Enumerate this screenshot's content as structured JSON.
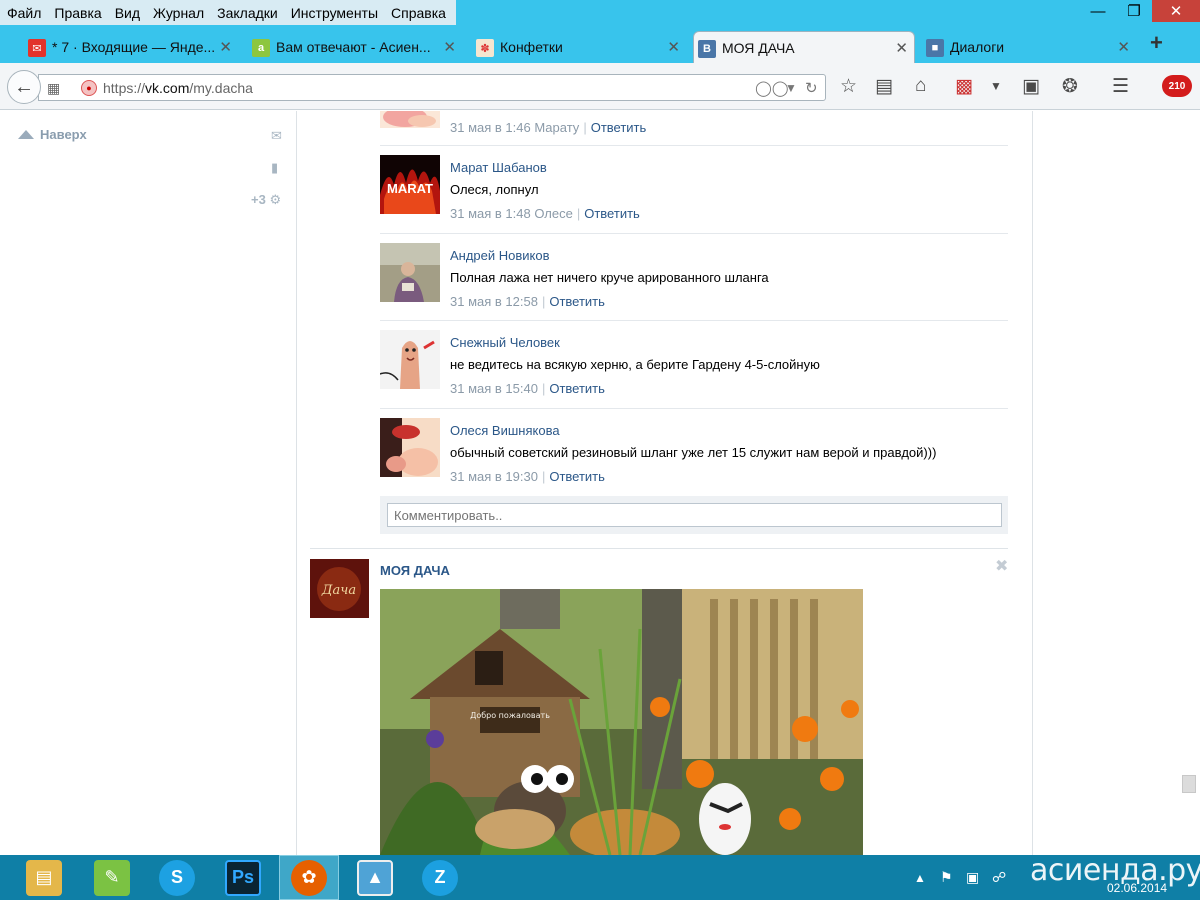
{
  "menubar": {
    "items": [
      "Файл",
      "Правка",
      "Вид",
      "Журнал",
      "Закладки",
      "Инструменты",
      "Справка"
    ]
  },
  "tabs": [
    {
      "label": "* 7 · Входящие — Янде...",
      "icon": "mail-icon",
      "color": "#e2332b"
    },
    {
      "label": "Вам отвечают - Асиен...",
      "icon": "asienda-icon",
      "color": "#8dc63f"
    },
    {
      "label": "Конфетки",
      "icon": "candy-icon",
      "color": "#f0a500"
    },
    {
      "label": "МОЯ ДАЧА",
      "icon": "vk-icon",
      "color": "#4a76a8",
      "active": true
    },
    {
      "label": "Диалоги",
      "icon": "dialogs-icon",
      "color": "#4a76a8"
    }
  ],
  "navbar": {
    "url_prefix": "https://",
    "url_host": "vk.com",
    "url_path": "/my.dacha",
    "badge": "210"
  },
  "sidebar": {
    "top_label": "Наверх",
    "counter": "+3"
  },
  "comments": [
    {
      "author": "",
      "text": "",
      "meta": "31 мая в 1:46 Марату",
      "reply": "Ответить",
      "avatar": "nails-avatar"
    },
    {
      "author": "Марат Шабанов",
      "text": "Олеся, лопнул",
      "meta": "31 мая в 1:48 Олесе",
      "reply": "Ответить",
      "avatar": "marat-avatar",
      "avatar_text": "MARAT"
    },
    {
      "author": "Андрей Новиков",
      "text": "Полная лажа нет ничего круче арированного шланга",
      "meta": "31 мая в 12:58",
      "reply": "Ответить",
      "avatar": "person-avatar"
    },
    {
      "author": "Снежный Человек",
      "text": "не ведитесь на всякую херню, а берите Гардену 4-5-слойную",
      "meta": "31 мая в 15:40",
      "reply": "Ответить",
      "avatar": "finger-avatar"
    },
    {
      "author": "Олеся Вишнякова",
      "text": "обычный советский резиновый шланг уже лет 15 служит нам верой и правдой)))",
      "meta": "31 мая в 19:30",
      "reply": "Ответить",
      "avatar": "nails-avatar"
    }
  ],
  "comment_input": {
    "placeholder": "Комментировать.."
  },
  "post": {
    "title": "МОЯ ДАЧА",
    "avatar_text": "Дача",
    "sign_text": "Добро пожаловать"
  },
  "taskbar": {
    "apps": [
      "explorer-icon",
      "notepad-icon",
      "skype-icon",
      "photoshop-icon",
      "firefox-icon",
      "photo-viewer-icon",
      "zona-icon"
    ],
    "date": "02.06.2014"
  },
  "watermark": "асиенда.ру",
  "colors": {
    "titlebar": "#38c4ec",
    "link": "#2b5788",
    "meta": "#8b9aa8",
    "taskbar": "#0f7fa6"
  }
}
